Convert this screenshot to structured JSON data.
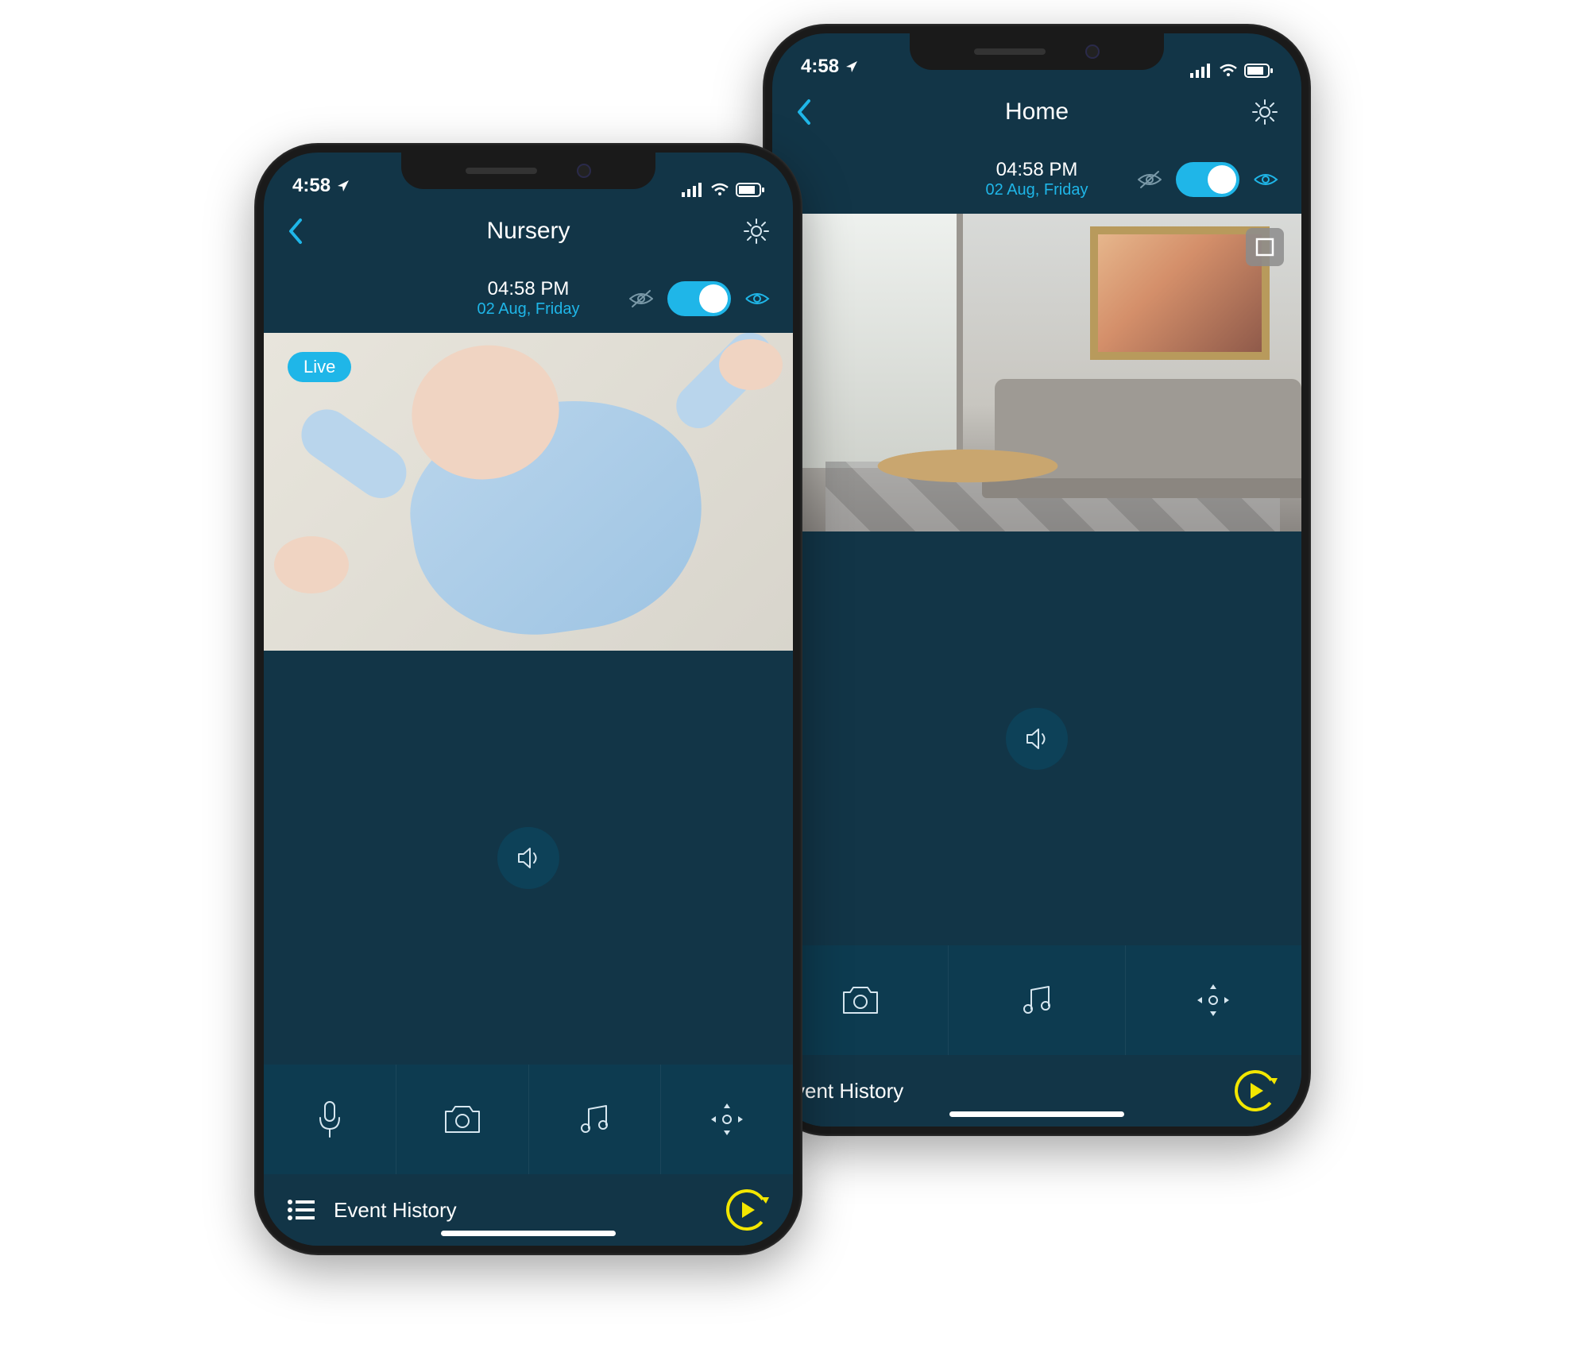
{
  "phoneA": {
    "statusTime": "4:58",
    "navTitle": "Nursery",
    "time": "04:58 PM",
    "date": "02 Aug, Friday",
    "liveBadge": "Live",
    "eventHistory": "Event History"
  },
  "phoneB": {
    "statusTime": "4:58",
    "navTitle": "Home",
    "time": "04:58 PM",
    "date": "02 Aug, Friday",
    "eventHistory": "vent History"
  },
  "colors": {
    "accent": "#1fb6e8",
    "bg": "#123547",
    "yellow": "#f2e600"
  }
}
